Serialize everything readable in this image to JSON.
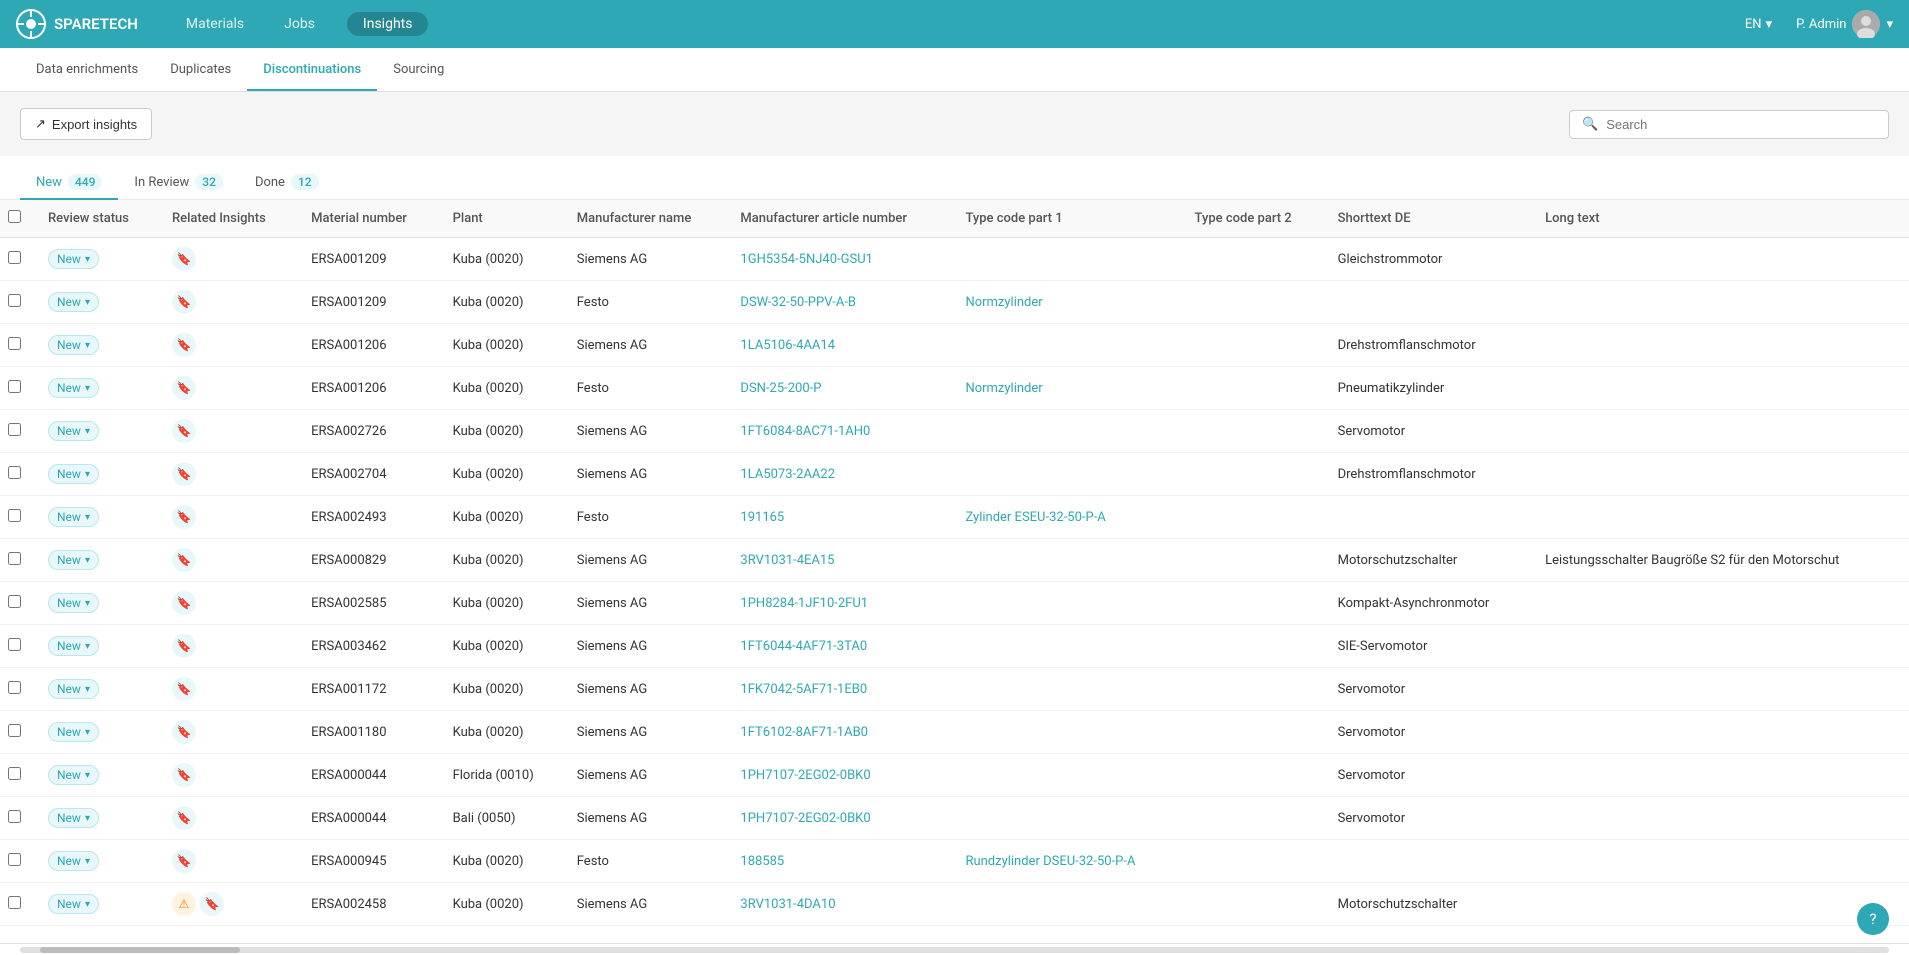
{
  "app": {
    "logo_text": "SPARETECH",
    "nav_items": [
      {
        "label": "Materials",
        "active": false
      },
      {
        "label": "Jobs",
        "active": false
      },
      {
        "label": "Insights",
        "active": true
      }
    ],
    "lang": "EN",
    "user_name": "P. Admin"
  },
  "sub_nav": {
    "items": [
      {
        "label": "Data enrichments",
        "active": false
      },
      {
        "label": "Duplicates",
        "active": false
      },
      {
        "label": "Discontinuations",
        "active": true
      },
      {
        "label": "Sourcing",
        "active": false
      }
    ]
  },
  "toolbar": {
    "export_label": "Export insights",
    "search_placeholder": "Search"
  },
  "status_tabs": {
    "items": [
      {
        "label": "New",
        "count": "449",
        "active": true
      },
      {
        "label": "In Review",
        "count": "32",
        "active": false
      },
      {
        "label": "Done",
        "count": "12",
        "active": false
      }
    ]
  },
  "table": {
    "columns": [
      {
        "key": "checkbox",
        "label": ""
      },
      {
        "key": "review_status",
        "label": "Review status"
      },
      {
        "key": "related_insights",
        "label": "Related Insights"
      },
      {
        "key": "material_number",
        "label": "Material number"
      },
      {
        "key": "plant",
        "label": "Plant"
      },
      {
        "key": "manufacturer_name",
        "label": "Manufacturer name"
      },
      {
        "key": "manufacturer_article_number",
        "label": "Manufacturer article number"
      },
      {
        "key": "type_code_part1",
        "label": "Type code part 1"
      },
      {
        "key": "type_code_part2",
        "label": "Type code part 2"
      },
      {
        "key": "shorttext_de",
        "label": "Shorttext DE"
      },
      {
        "key": "long_text",
        "label": "Long text"
      }
    ],
    "rows": [
      {
        "status": "New",
        "material_number": "ERSA001209",
        "plant": "Kuba (0020)",
        "manufacturer": "Siemens AG",
        "article_number": "1GH5354-5NJ40-GSU1",
        "type1": "",
        "type2": "",
        "shorttext": "Gleichstrommotor",
        "longtext": "",
        "has_orange_icon": false
      },
      {
        "status": "New",
        "material_number": "ERSA001209",
        "plant": "Kuba (0020)",
        "manufacturer": "Festo",
        "article_number": "DSW-32-50-PPV-A-B",
        "type1": "Normzylinder",
        "type2": "",
        "shorttext": "",
        "longtext": "",
        "has_orange_icon": false
      },
      {
        "status": "New",
        "material_number": "ERSA001206",
        "plant": "Kuba (0020)",
        "manufacturer": "Siemens AG",
        "article_number": "1LA5106-4AA14",
        "type1": "",
        "type2": "",
        "shorttext": "Drehstromflanschmotor",
        "longtext": "",
        "has_orange_icon": false
      },
      {
        "status": "New",
        "material_number": "ERSA001206",
        "plant": "Kuba (0020)",
        "manufacturer": "Festo",
        "article_number": "DSN-25-200-P",
        "type1": "Normzylinder",
        "type2": "",
        "shorttext": "Pneumatikzylinder",
        "longtext": "",
        "has_orange_icon": false
      },
      {
        "status": "New",
        "material_number": "ERSA002726",
        "plant": "Kuba (0020)",
        "manufacturer": "Siemens AG",
        "article_number": "1FT6084-8AC71-1AH0",
        "type1": "",
        "type2": "",
        "shorttext": "Servomotor",
        "longtext": "",
        "has_orange_icon": false
      },
      {
        "status": "New",
        "material_number": "ERSA002704",
        "plant": "Kuba (0020)",
        "manufacturer": "Siemens AG",
        "article_number": "1LA5073-2AA22",
        "type1": "",
        "type2": "",
        "shorttext": "Drehstromflanschmotor",
        "longtext": "",
        "has_orange_icon": false
      },
      {
        "status": "New",
        "material_number": "ERSA002493",
        "plant": "Kuba (0020)",
        "manufacturer": "Festo",
        "article_number": "191165",
        "type1": "Zylinder ESEU-32-50-P-A",
        "type2": "",
        "shorttext": "",
        "longtext": "",
        "has_orange_icon": false
      },
      {
        "status": "New",
        "material_number": "ERSA000829",
        "plant": "Kuba (0020)",
        "manufacturer": "Siemens AG",
        "article_number": "3RV1031-4EA15",
        "type1": "",
        "type2": "",
        "shorttext": "Motorschutzschalter",
        "longtext": "Leistungsschalter Baugröße S2 für den Motorschut",
        "has_orange_icon": false
      },
      {
        "status": "New",
        "material_number": "ERSA002585",
        "plant": "Kuba (0020)",
        "manufacturer": "Siemens AG",
        "article_number": "1PH8284-1JF10-2FU1",
        "type1": "",
        "type2": "",
        "shorttext": "Kompakt-Asynchronmotor",
        "longtext": "",
        "has_orange_icon": false
      },
      {
        "status": "New",
        "material_number": "ERSA003462",
        "plant": "Kuba (0020)",
        "manufacturer": "Siemens AG",
        "article_number": "1FT6044-4AF71-3TA0",
        "type1": "",
        "type2": "",
        "shorttext": "SIE-Servomotor",
        "longtext": "",
        "has_orange_icon": false
      },
      {
        "status": "New",
        "material_number": "ERSA001172",
        "plant": "Kuba (0020)",
        "manufacturer": "Siemens AG",
        "article_number": "1FK7042-5AF71-1EB0",
        "type1": "",
        "type2": "",
        "shorttext": "Servomotor",
        "longtext": "",
        "has_orange_icon": false
      },
      {
        "status": "New",
        "material_number": "ERSA001180",
        "plant": "Kuba (0020)",
        "manufacturer": "Siemens AG",
        "article_number": "1FT6102-8AF71-1AB0",
        "type1": "",
        "type2": "",
        "shorttext": "Servomotor",
        "longtext": "",
        "has_orange_icon": false
      },
      {
        "status": "New",
        "material_number": "ERSA000044",
        "plant": "Florida (0010)",
        "manufacturer": "Siemens AG",
        "article_number": "1PH7107-2EG02-0BK0",
        "type1": "",
        "type2": "",
        "shorttext": "Servomotor",
        "longtext": "",
        "has_orange_icon": false
      },
      {
        "status": "New",
        "material_number": "ERSA000044",
        "plant": "Bali (0050)",
        "manufacturer": "Siemens AG",
        "article_number": "1PH7107-2EG02-0BK0",
        "type1": "",
        "type2": "",
        "shorttext": "Servomotor",
        "longtext": "",
        "has_orange_icon": false
      },
      {
        "status": "New",
        "material_number": "ERSA000945",
        "plant": "Kuba (0020)",
        "manufacturer": "Festo",
        "article_number": "188585",
        "type1": "Rundzylinder DSEU-32-50-P-A",
        "type2": "",
        "shorttext": "",
        "longtext": "",
        "has_orange_icon": false
      },
      {
        "status": "New",
        "material_number": "ERSA002458",
        "plant": "Kuba (0020)",
        "manufacturer": "Siemens AG",
        "article_number": "3RV1031-4DA10",
        "type1": "",
        "type2": "",
        "shorttext": "Motorschutzschalter",
        "longtext": "",
        "has_orange_icon": true
      }
    ]
  },
  "help_button_label": "?"
}
